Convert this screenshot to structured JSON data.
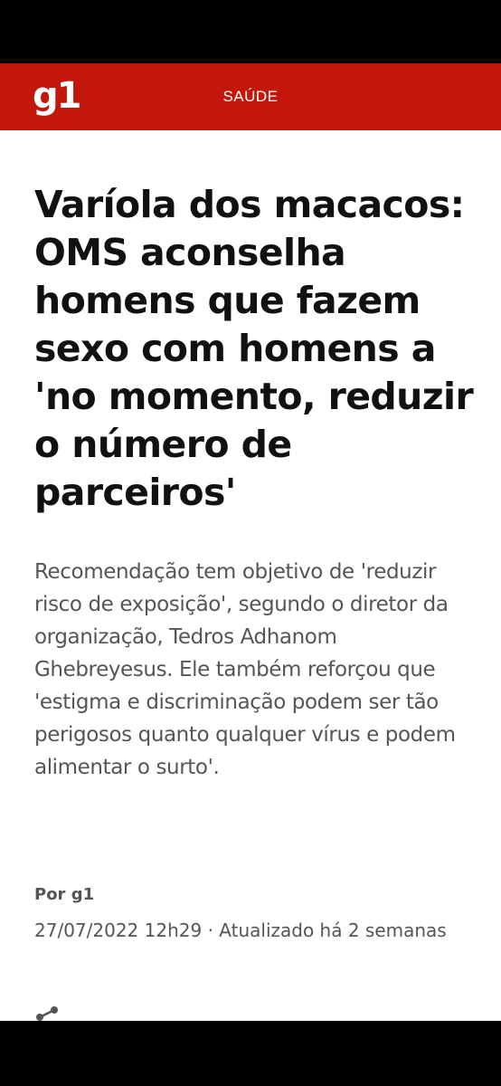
{
  "header": {
    "logo_text": "g1",
    "section": "SAÚDE",
    "brand_color": "#c4170c"
  },
  "article": {
    "headline": "Varíola dos macacos: OMS aconselha homens que fazem sexo com homens a 'no momento, reduzir o número de parceiros'",
    "subtitle": "Recomendação tem objetivo de 'reduzir risco de exposição', segundo o diretor da organização, Tedros Adhanom Ghebreyesus. Ele também reforçou que 'estigma e discriminação podem ser tão perigosos quanto qualquer vírus e podem alimentar o surto'.",
    "byline": "Por g1",
    "dateline": "27/07/2022 12h29 · Atualizado há 2 semanas"
  },
  "icons": {
    "share": "share-icon"
  }
}
